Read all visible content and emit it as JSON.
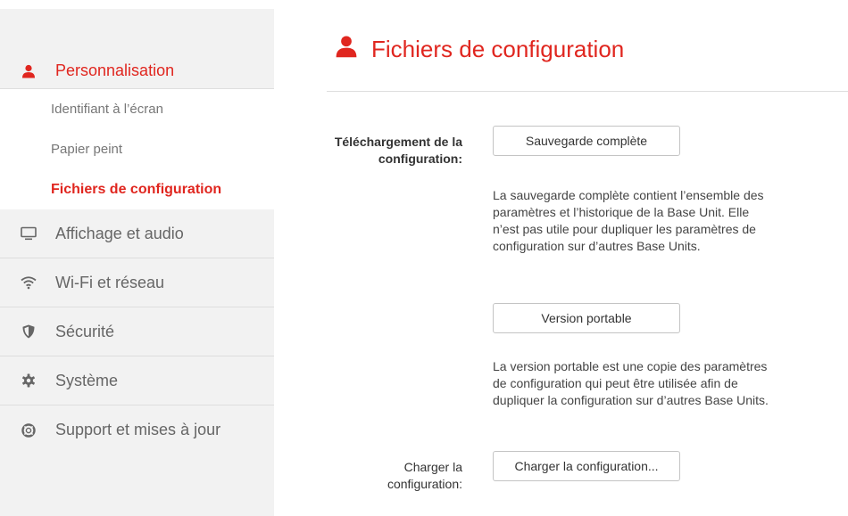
{
  "sidebar": {
    "section": {
      "label": "Personnalisation",
      "icon": "user-icon",
      "items": [
        {
          "label": "Identifiant à l’écran",
          "active": false
        },
        {
          "label": "Papier peint",
          "active": false
        },
        {
          "label": "Fichiers de configuration",
          "active": true
        }
      ]
    },
    "items": [
      {
        "label": "Affichage et audio",
        "icon": "monitor-icon"
      },
      {
        "label": "Wi-Fi et réseau",
        "icon": "wifi-icon"
      },
      {
        "label": "Sécurité",
        "icon": "shield-icon"
      },
      {
        "label": "Système",
        "icon": "gear-icon"
      },
      {
        "label": "Support et mises à jour",
        "icon": "lifebuoy-icon"
      }
    ]
  },
  "page": {
    "title": "Fichiers de configuration",
    "title_icon": "user-icon",
    "download": {
      "label": "Téléchargement de la configuration:",
      "full_backup_button": "Sauvegarde complète",
      "full_backup_desc": "La sauvegarde complète contient l’ensemble des paramètres et l’historique de la Base Unit. Elle n’est pas utile pour dupliquer les paramètres de configuration sur d’autres Base Units.",
      "portable_button": "Version portable",
      "portable_desc": "La version portable est une copie des paramètres de configuration qui peut être utilisée afin de dupliquer la configuration sur d’autres Base Units."
    },
    "upload": {
      "label": "Charger la configuration:",
      "button": "Charger la configuration..."
    }
  },
  "colors": {
    "accent": "#e0261f",
    "sidebar_bg": "#f2f2f2",
    "divider": "#dedede"
  }
}
